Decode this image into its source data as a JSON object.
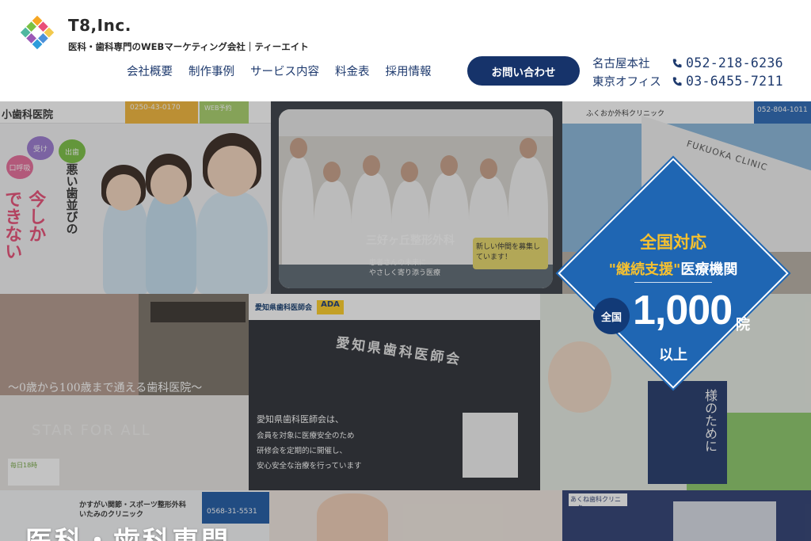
{
  "brand": {
    "name": "T8,Inc.",
    "tagline": "医科・歯科専門のWEBマーケティング会社｜ティーエイト"
  },
  "nav": {
    "items": [
      "会社概要",
      "制作事例",
      "サービス内容",
      "料金表",
      "採用情報"
    ]
  },
  "cta": {
    "label": "お問い合わせ"
  },
  "offices": [
    {
      "name": "名古屋本社",
      "phone": "052-218-6236"
    },
    {
      "name": "東京オフィス",
      "phone": "03-6455-7211"
    }
  ],
  "badge": {
    "nationwide": "全国対応",
    "support_quote": "\"継続支援\"",
    "support_rest": "医療機関",
    "circle": "全国",
    "count": "1,000",
    "unit": "院",
    "suffix": "以上"
  },
  "hero": {
    "headline": "医科・歯科専門"
  },
  "tiles": {
    "t1": {
      "clinic": "小歯科医院",
      "tel": "0250-43-0170",
      "web": "WEB予約",
      "vt1": "悪い歯並びの",
      "vt2": "今しか",
      "vt3": "できない",
      "bubbles": [
        "受け",
        "出歯",
        "口呼吸"
      ]
    },
    "t2": {
      "name": "三好ヶ丘整形外科",
      "sub1": "患者さんの未来に",
      "sub2": "やさしく寄り添う医療",
      "badge": "新しい仲間を募集しています！"
    },
    "t3": {
      "clinic": "ふくおか外科クリニック",
      "tel": "052-804-1011",
      "sign": "FUKUOKA CLINIC"
    },
    "t4": {
      "script": "〜0歳から100歳まで通える歯科医院〜",
      "star": "STAR FOR ALL",
      "days": "毎日18時"
    },
    "t5": {
      "org": "愛知県歯科医師会",
      "ada": "ADA",
      "sign": "愛知県歯科医師会",
      "line1": "愛知県歯科医師会は、",
      "line2": "会員を対象に医療安全のため",
      "line3": "研修会を定期的に開催し、",
      "line4": "安心安全な治療を行っています"
    },
    "t6": {
      "vtext": "様のために"
    },
    "t7": {
      "line1": "かすがい関節・スポーツ整形外科",
      "line2": "いたみのクリニック",
      "tel": "0568-31-5531"
    },
    "t9": {
      "label": "あくね歯科クリニック"
    }
  },
  "colors": {
    "navy": "#16336a",
    "badge_blue": "#1f66b3",
    "badge_yellow": "#f6c12f"
  }
}
